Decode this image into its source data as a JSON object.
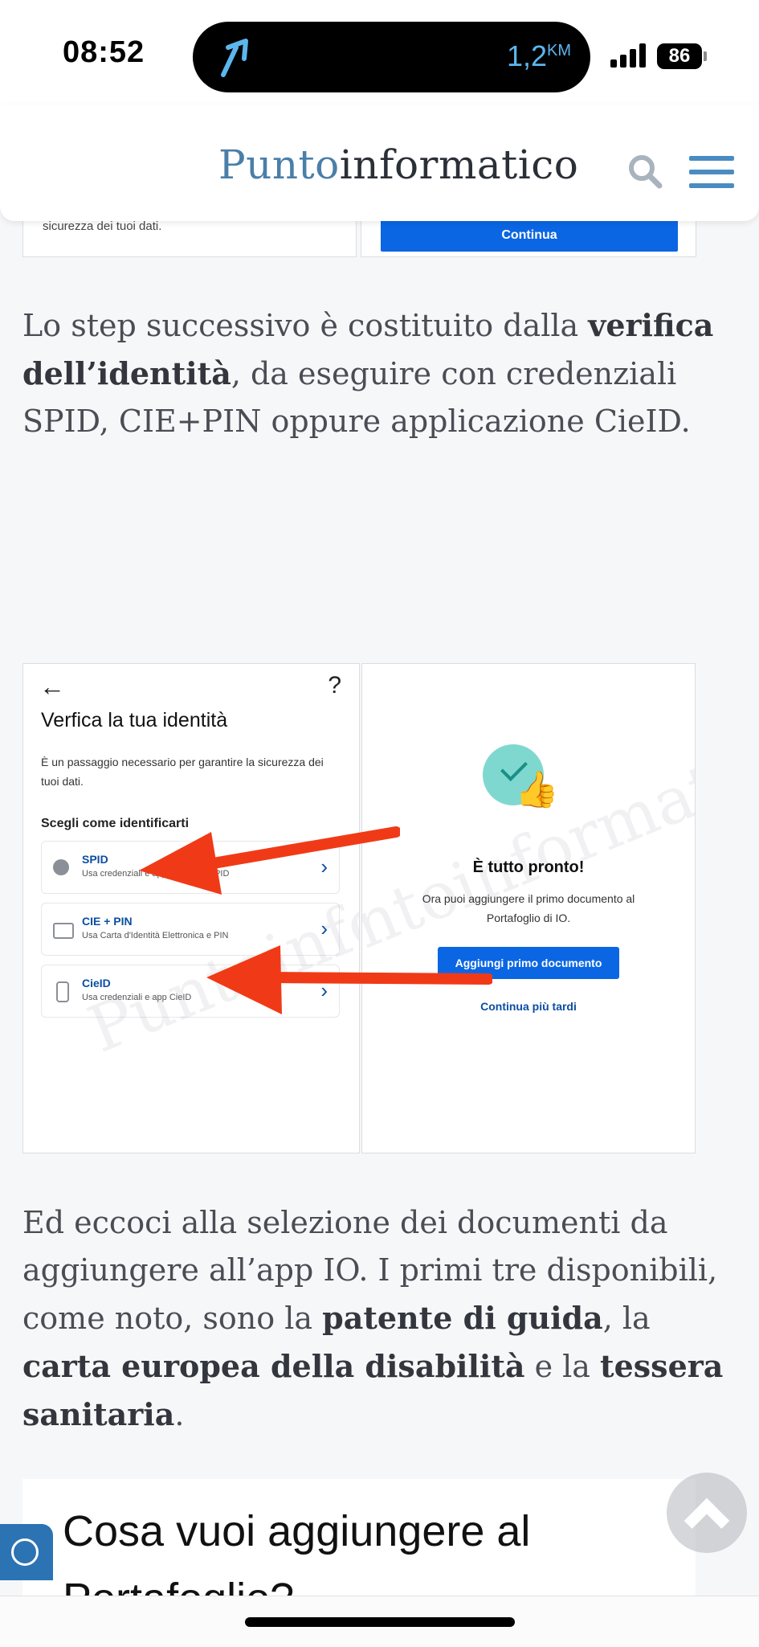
{
  "status_bar": {
    "time": "08:52",
    "navigation_distance": "1,2",
    "distance_unit": "KM",
    "battery": "86",
    "accent_color": "#5cb6ee"
  },
  "header": {
    "logo_part1": "Punto",
    "logo_part2": "informatico",
    "logo_color1": "#4a7fa8",
    "icons": [
      "search-icon",
      "menu-icon"
    ]
  },
  "top_image": {
    "left_text": "sicurezza dei tuoi dati.",
    "button_label": "Continua"
  },
  "paragraph1": {
    "before": "Lo step successivo è costituito dalla ",
    "bold": "verifica dell’identità",
    "after": ", da eseguire con credenziali SPID, CIE+PIN oppure applicazione CieID."
  },
  "screenshot_left": {
    "back_icon": "←",
    "help_icon": "?",
    "title": "Verfica la tua identità",
    "description": "È un passaggio necessario per garantire la sicurezza dei tuoi dati.",
    "choose_label": "Scegli come identificarti",
    "options": [
      {
        "label": "SPID",
        "sub": "Usa credenziali e app fornite da SPID",
        "icon": "user-icon"
      },
      {
        "label": "CIE + PIN",
        "sub": "Usa Carta d'Identità Elettronica e PIN",
        "icon": "id-card-icon"
      },
      {
        "label": "CieID",
        "sub": "Usa credenziali e app CieID",
        "icon": "phone-icon"
      }
    ],
    "watermark": "Puntoinformatico"
  },
  "screenshot_right": {
    "title": "È tutto pronto!",
    "description": "Ora puoi aggiungere il primo documento al Portafoglio di IO.",
    "primary_button": "Aggiungi primo documento",
    "secondary_link": "Continua più tardi",
    "watermark": "Puntoinformatico"
  },
  "paragraph2": {
    "t1": "Ed eccoci alla selezione dei documenti da aggiungere all’app IO. I primi tre disponibili, come noto, sono la ",
    "b1": "patente di guida",
    "t2": ", la ",
    "b2": "carta europea della disabilità",
    "t3": " e la ",
    "b3": "tessera sanitaria",
    "t4": "."
  },
  "bottom_card": {
    "heading_line1": "Cosa vuoi aggiungere al",
    "heading_line2": "Portafoglio?"
  },
  "floating": {
    "scroll_top_icon": "chevron-up-icon",
    "cookie_icon": "cookie-icon"
  }
}
